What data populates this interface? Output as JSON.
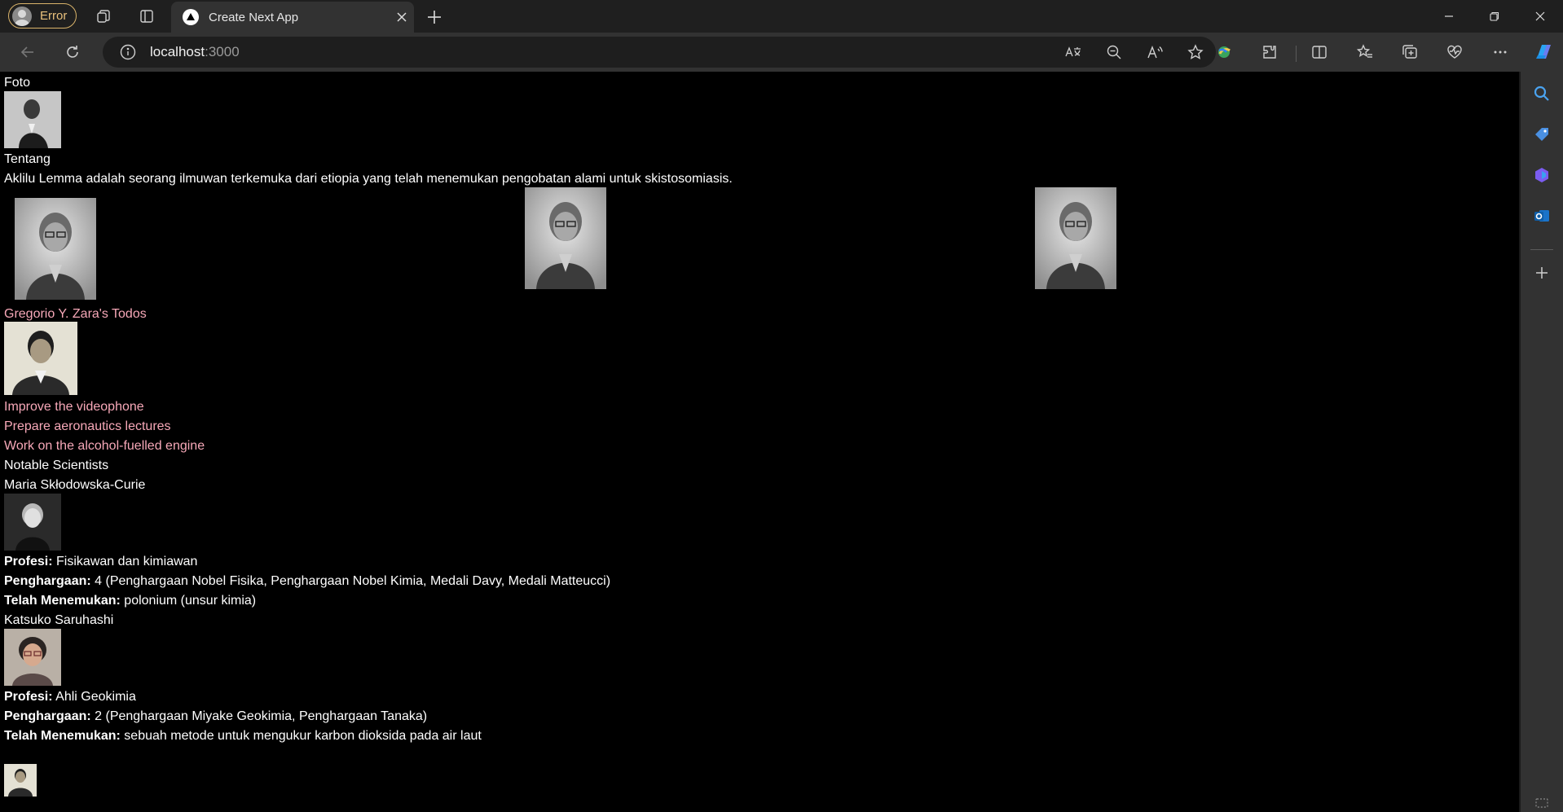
{
  "browser": {
    "profile_label": "Error",
    "tab_title": "Create Next App",
    "url_host": "localhost",
    "url_port": ":3000"
  },
  "colors": {
    "link_pink": "#f7a8b8",
    "chrome_dark": "#1f1f1f",
    "chrome_mid": "#323232"
  },
  "icons": [
    "workspaces-icon",
    "tab-actions-icon",
    "translate-icon",
    "zoom-out-icon",
    "read-aloud-icon",
    "favorite-star-icon",
    "copilot-icon",
    "extensions-icon",
    "split-screen-icon",
    "favorites-icon",
    "collections-icon",
    "browser-essentials-icon",
    "more-icon",
    "search-icon",
    "shopping-icon",
    "copilot-icon",
    "outlook-icon"
  ],
  "page": {
    "foto_label": "Foto",
    "tentang_label": "Tentang",
    "about_text": "Aklilu Lemma adalah seorang ilmuwan terkemuka dari etiopia yang telah menemukan pengobatan alami untuk skistosomiasis.",
    "todos_title": "Gregorio Y. Zara's Todos",
    "todos": [
      "Improve the videophone",
      "Prepare aeronautics lectures",
      "Work on the alcohol-fuelled engine"
    ],
    "gallery_title": "Notable Scientists",
    "scientists": [
      {
        "name": "Maria Skłodowska-Curie",
        "profession_label": "Profesi:",
        "profession": "Fisikawan dan kimiawan",
        "awards_label": "Penghargaan:",
        "awards": "4 (Penghargaan Nobel Fisika, Penghargaan Nobel Kimia, Medali Davy, Medali Matteucci)",
        "discovered_label": "Telah Menemukan:",
        "discovered": "polonium (unsur kimia)"
      },
      {
        "name": "Katsuko Saruhashi",
        "profession_label": "Profesi:",
        "profession": "Ahli Geokimia",
        "awards_label": "Penghargaan:",
        "awards": "2 (Penghargaan Miyake Geokimia, Penghargaan Tanaka)",
        "discovered_label": "Telah Menemukan:",
        "discovered": "sebuah metode untuk mengukur karbon dioksida pada air laut"
      }
    ]
  }
}
